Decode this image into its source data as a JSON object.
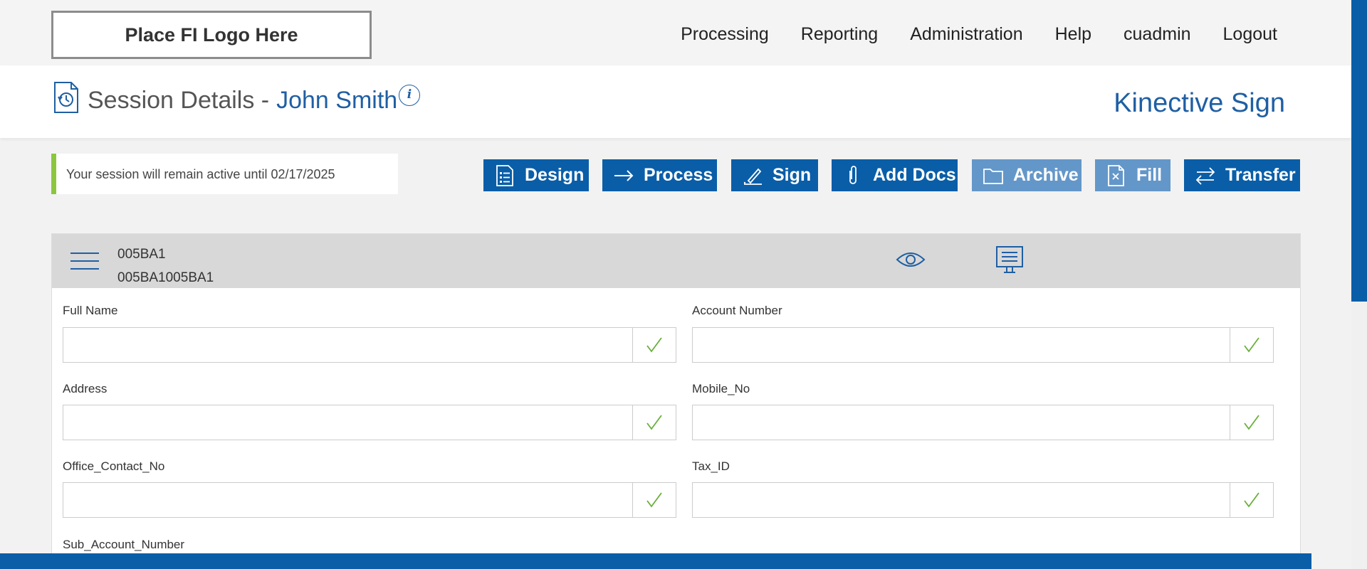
{
  "header": {
    "logo_text": "Place FI Logo Here",
    "nav": [
      "Processing",
      "Reporting",
      "Administration",
      "Help",
      "cuadmin",
      "Logout"
    ]
  },
  "page": {
    "title_prefix": "Session Details -",
    "title_name": "John Smith",
    "info_glyph": "i",
    "brand": "Kinective Sign"
  },
  "notice": {
    "text": "Your session will remain active until 02/17/2025",
    "accent_color": "#8cc63f"
  },
  "actions": {
    "design": "Design",
    "process": "Process",
    "sign": "Sign",
    "add_docs": "Add Docs",
    "archive": "Archive",
    "fill": "Fill",
    "transfer": "Transfer"
  },
  "document": {
    "line1": "005BA1",
    "line2": "005BA1005BA1"
  },
  "fields": {
    "full_name": {
      "label": "Full Name",
      "value": ""
    },
    "account_number": {
      "label": "Account Number",
      "value": ""
    },
    "address": {
      "label": "Address",
      "value": ""
    },
    "mobile_no": {
      "label": "Mobile_No",
      "value": ""
    },
    "office_contact_no": {
      "label": "Office_Contact_No",
      "value": ""
    },
    "tax_id": {
      "label": "Tax_ID",
      "value": ""
    },
    "sub_account_number": {
      "label": "Sub_Account_Number",
      "value": ""
    }
  },
  "colors": {
    "primary": "#0a5ea8",
    "primary_light": "#6497c9",
    "brand_text": "#1f5fa3",
    "check": "#6aaf3b"
  }
}
